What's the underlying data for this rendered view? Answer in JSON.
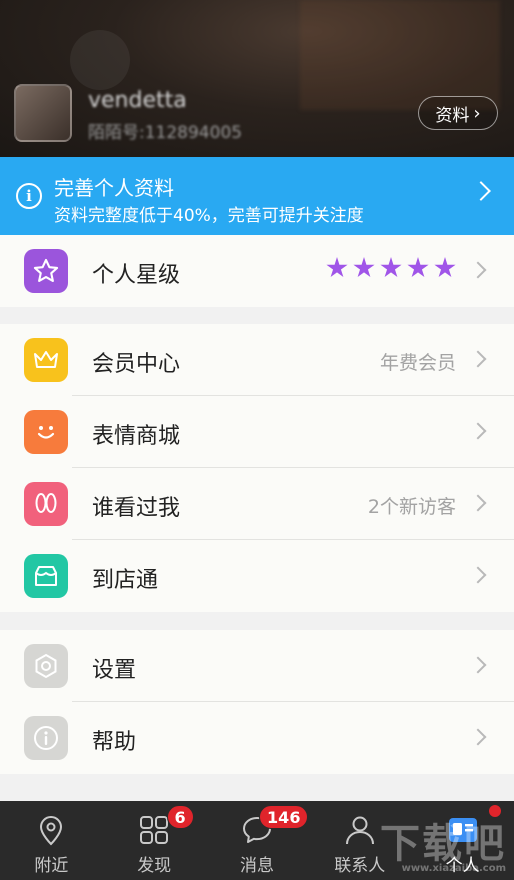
{
  "header": {
    "username": "vendetta",
    "user_id": "陌陌号:112894005",
    "profile_button": "资料"
  },
  "banner": {
    "title": "完善个人资料",
    "subtitle": "资料完整度低于40%，完善可提升关注度"
  },
  "sections": [
    {
      "rows": [
        {
          "label": "个人星级",
          "value": "",
          "stars": 5,
          "icon": "star-icon",
          "color": "#9b55dc"
        }
      ]
    },
    {
      "rows": [
        {
          "label": "会员中心",
          "value": "年费会员",
          "icon": "crown-icon",
          "color": "#f8c21c"
        },
        {
          "label": "表情商城",
          "value": "",
          "icon": "smile-icon",
          "color": "#f77b3c"
        },
        {
          "label": "谁看过我",
          "value": "2个新访客",
          "icon": "footprint-icon",
          "color": "#f1617c"
        },
        {
          "label": "到店通",
          "value": "",
          "icon": "store-icon",
          "color": "#22c7a4"
        }
      ]
    },
    {
      "rows": [
        {
          "label": "设置",
          "value": "",
          "icon": "settings-icon",
          "color": "#d6d6d3"
        },
        {
          "label": "帮助",
          "value": "",
          "icon": "help-icon",
          "color": "#d6d6d3"
        }
      ]
    }
  ],
  "tabbar": {
    "tabs": [
      {
        "label": "附近",
        "icon": "location-pin-icon",
        "badge": ""
      },
      {
        "label": "发现",
        "icon": "grid-icon",
        "badge": "6"
      },
      {
        "label": "消息",
        "icon": "chat-bubble-icon",
        "badge": "146"
      },
      {
        "label": "联系人",
        "icon": "person-icon",
        "badge": ""
      },
      {
        "label": "个人",
        "icon": "profile-card-icon",
        "badge": "",
        "dot": true,
        "active": true
      }
    ]
  },
  "watermark": {
    "main": "下载吧",
    "sub": "www.xiazaiba.com"
  },
  "colors": {
    "accent_blue": "#29a9f2",
    "badge_red": "#e0242b",
    "star_purple": "#a055e8"
  }
}
